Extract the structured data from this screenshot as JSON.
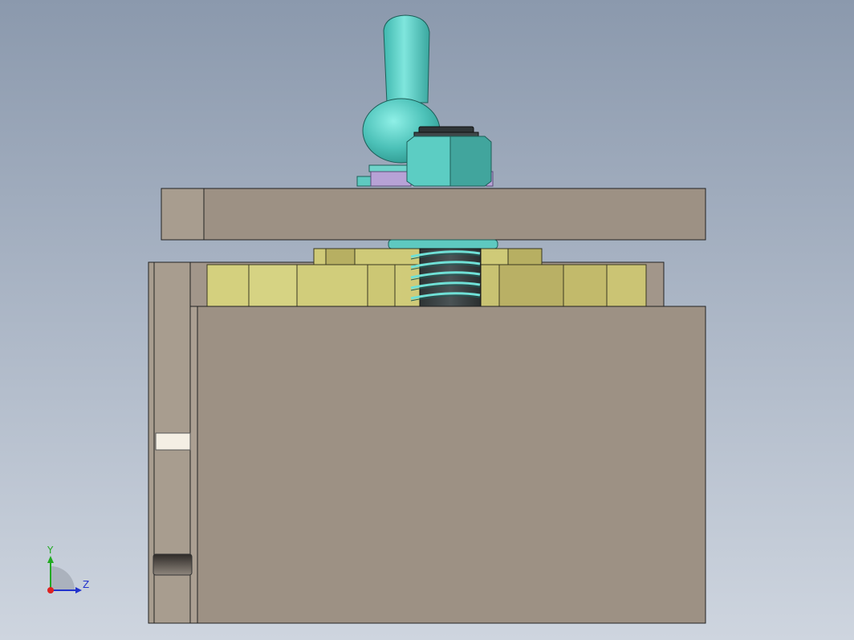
{
  "viewport": {
    "background_top": "#8b99ad",
    "background_bottom": "#ced5df"
  },
  "triad": {
    "y_label": "Y",
    "z_label": "Z",
    "y_axis_color": "#22aa22",
    "z_axis_color": "#2233cc",
    "origin_color": "#dd2222"
  },
  "colors": {
    "plate": "#9d9184",
    "plate_light": "#a79c8e",
    "brass": "#c9c476",
    "cyan": "#5ec9c0",
    "hex_nut": "#4dbab0",
    "lavender": "#b7a2d6"
  }
}
